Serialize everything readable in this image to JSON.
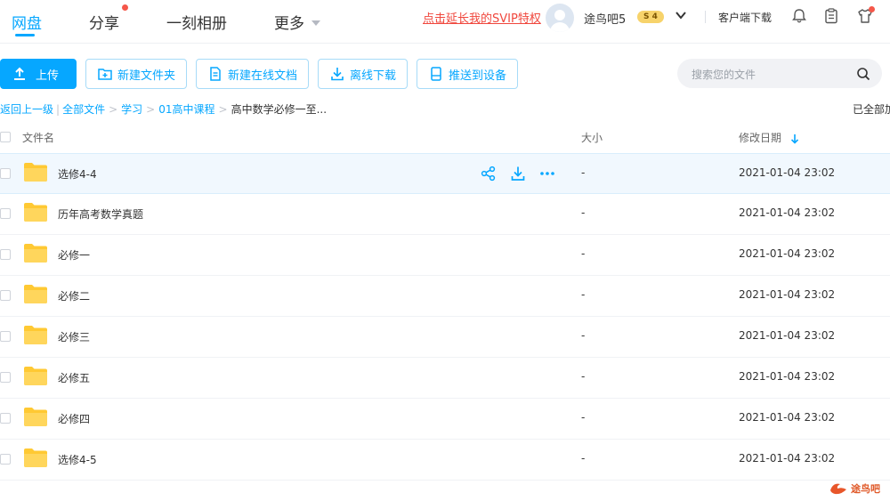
{
  "topnav": {
    "items": [
      "网盘",
      "分享",
      "一刻相册",
      "更多"
    ],
    "promo": "点击延长我的SVIP特权",
    "username": "途鸟吧5",
    "badge": "S 4",
    "client_download": "客户端下载"
  },
  "toolbar": {
    "upload": "上传",
    "new_folder": "新建文件夹",
    "new_doc": "新建在线文档",
    "offline": "离线下载",
    "push_device": "推送到设备",
    "search_placeholder": "搜索您的文件"
  },
  "breadcrumb": {
    "back": "返回上一级",
    "items": [
      "全部文件",
      "学习",
      "01高中课程",
      "高中数学必修一至..."
    ],
    "loaded": "已全部加"
  },
  "table": {
    "headers": {
      "name": "文件名",
      "size": "大小",
      "date": "修改日期"
    },
    "rows": [
      {
        "name": "选修4-4",
        "size": "-",
        "date": "2021-01-04 23:02"
      },
      {
        "name": "历年高考数学真题",
        "size": "-",
        "date": "2021-01-04 23:02"
      },
      {
        "name": "必修一",
        "size": "-",
        "date": "2021-01-04 23:02"
      },
      {
        "name": "必修二",
        "size": "-",
        "date": "2021-01-04 23:02"
      },
      {
        "name": "必修三",
        "size": "-",
        "date": "2021-01-04 23:02"
      },
      {
        "name": "必修五",
        "size": "-",
        "date": "2021-01-04 23:02"
      },
      {
        "name": "必修四",
        "size": "-",
        "date": "2021-01-04 23:02"
      },
      {
        "name": "选修4-5",
        "size": "-",
        "date": "2021-01-04 23:02"
      }
    ]
  },
  "watermark": "途鸟吧",
  "colors": {
    "accent": "#06a7ff",
    "folder": "#ffd157",
    "promo": "#f0473d"
  }
}
